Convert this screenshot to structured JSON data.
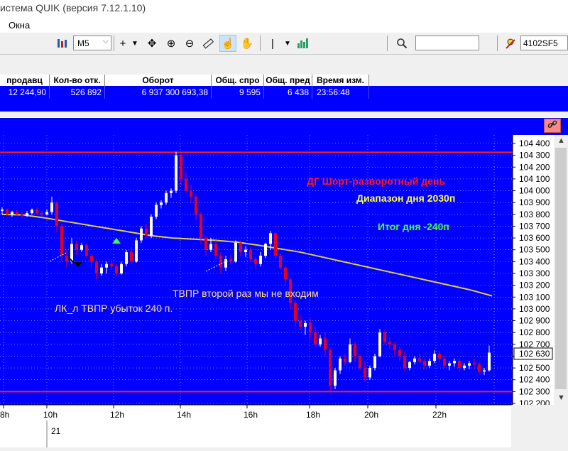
{
  "window": {
    "title": "истема QUIK (версия 7.12.1.10)"
  },
  "menu": {
    "items": [
      "Окна"
    ]
  },
  "toolbar": {
    "timeframe": "M5",
    "instrument": "4102SF5",
    "search_value": ""
  },
  "table": {
    "columns": [
      "продавц",
      "Кол-во отк.",
      "Оборот",
      "Общ. спро",
      "Общ. пред",
      "Время изм."
    ],
    "row": [
      "12 244,90",
      "526 892",
      "6 937 300 693,38",
      "9 595",
      "6 438",
      "23:56:48"
    ]
  },
  "chart": {
    "annotations": {
      "day_type": "ДГ Шорт-разворотный день",
      "day_range": "Диапазон дня 2030п",
      "day_total": "Итог дня -240п",
      "note_tvpr": "ТВПР второй раз мы не входим",
      "note_loss": "ЛК_л ТВПР убыток 240 п."
    },
    "current_price_label": "102 630",
    "date_label": "21",
    "colors": {
      "background": "#0000ff",
      "bull": "#ffffff",
      "bear": "#e8001a",
      "ma": "#e0d040",
      "level": "#ff2020",
      "grid": "#c0c0ff",
      "annotation_red": "#ff1a1a",
      "annotation_yellow": "#ffff40",
      "annotation_green": "#40ff40",
      "note_text": "#ffe080"
    }
  },
  "chart_data": {
    "type": "candlestick",
    "y_axis": {
      "min": 102200,
      "max": 104400,
      "ticks": [
        "104 400",
        "104 300",
        "104 200",
        "104 100",
        "104 000",
        "103 900",
        "103 800",
        "103 700",
        "103 600",
        "103 500",
        "103 400",
        "103 300",
        "103 200",
        "103 100",
        "103 000",
        "102 900",
        "102 800",
        "102 700",
        "102 600",
        "102 500",
        "102 400",
        "102 300",
        "102 200"
      ]
    },
    "x_axis": {
      "ticks": [
        "8h",
        "10h",
        "12h",
        "14h",
        "16h",
        "18h",
        "20h",
        "22h"
      ]
    },
    "levels": [
      104325,
      102300
    ],
    "ma_series": [
      [
        0,
        103800
      ],
      [
        5,
        103795
      ],
      [
        10,
        103770
      ],
      [
        15,
        103740
      ],
      [
        20,
        103710
      ],
      [
        25,
        103680
      ],
      [
        30,
        103650
      ],
      [
        35,
        103620
      ],
      [
        40,
        103600
      ],
      [
        45,
        103590
      ],
      [
        50,
        103580
      ],
      [
        55,
        103565
      ],
      [
        60,
        103540
      ],
      [
        65,
        103510
      ],
      [
        70,
        103480
      ],
      [
        75,
        103440
      ],
      [
        80,
        103400
      ],
      [
        85,
        103360
      ],
      [
        90,
        103320
      ],
      [
        95,
        103280
      ],
      [
        100,
        103240
      ],
      [
        105,
        103200
      ],
      [
        110,
        103160
      ],
      [
        115,
        103110
      ]
    ],
    "candles": [
      [
        0,
        103830,
        103860,
        103800,
        103840
      ],
      [
        1,
        103840,
        103850,
        103790,
        103800
      ],
      [
        2,
        103800,
        103830,
        103780,
        103820
      ],
      [
        3,
        103820,
        103840,
        103790,
        103800
      ],
      [
        4,
        103800,
        103820,
        103770,
        103790
      ],
      [
        5,
        103790,
        103830,
        103780,
        103810
      ],
      [
        6,
        103810,
        103850,
        103800,
        103840
      ],
      [
        7,
        103840,
        103860,
        103800,
        103810
      ],
      [
        8,
        103810,
        103830,
        103780,
        103800
      ],
      [
        9,
        103800,
        103840,
        103790,
        103820
      ],
      [
        10,
        103820,
        103950,
        103800,
        103900
      ],
      [
        11,
        103900,
        103910,
        103650,
        103700
      ],
      [
        12,
        103700,
        103720,
        103400,
        103450
      ],
      [
        13,
        103450,
        103500,
        103350,
        103400
      ],
      [
        14,
        103400,
        103600,
        103380,
        103550
      ],
      [
        15,
        103550,
        103580,
        103450,
        103500
      ],
      [
        16,
        103500,
        103560,
        103480,
        103540
      ],
      [
        17,
        103540,
        103550,
        103430,
        103450
      ],
      [
        18,
        103450,
        103470,
        103350,
        103400
      ],
      [
        19,
        103400,
        103420,
        103250,
        103300
      ],
      [
        20,
        103300,
        103380,
        103280,
        103350
      ],
      [
        21,
        103350,
        103400,
        103300,
        103380
      ],
      [
        22,
        103380,
        103420,
        103330,
        103360
      ],
      [
        23,
        103360,
        103380,
        103280,
        103300
      ],
      [
        24,
        103300,
        103400,
        103290,
        103380
      ],
      [
        25,
        103380,
        103500,
        103360,
        103480
      ],
      [
        26,
        103480,
        103520,
        103380,
        103400
      ],
      [
        27,
        103400,
        103600,
        103390,
        103580
      ],
      [
        28,
        103580,
        103700,
        103560,
        103680
      ],
      [
        29,
        103680,
        103720,
        103600,
        103620
      ],
      [
        30,
        103620,
        103800,
        103600,
        103780
      ],
      [
        31,
        103780,
        103900,
        103760,
        103880
      ],
      [
        32,
        103880,
        103920,
        103850,
        103900
      ],
      [
        33,
        103900,
        104000,
        103880,
        103980
      ],
      [
        34,
        103980,
        104020,
        103940,
        104000
      ],
      [
        35,
        104000,
        104330,
        103980,
        104300
      ],
      [
        36,
        104300,
        104320,
        104050,
        104100
      ],
      [
        37,
        104100,
        104150,
        103980,
        104000
      ],
      [
        38,
        104000,
        104050,
        103900,
        103950
      ],
      [
        39,
        103950,
        103970,
        103750,
        103800
      ],
      [
        40,
        103800,
        103820,
        103550,
        103600
      ],
      [
        41,
        103600,
        103620,
        103450,
        103500
      ],
      [
        42,
        103500,
        103600,
        103480,
        103550
      ],
      [
        43,
        103550,
        103580,
        103420,
        103450
      ],
      [
        44,
        103450,
        103480,
        103300,
        103350
      ],
      [
        45,
        103350,
        103450,
        103320,
        103420
      ],
      [
        46,
        103420,
        103460,
        103380,
        103400
      ],
      [
        47,
        103400,
        103580,
        103390,
        103560
      ],
      [
        48,
        103560,
        103580,
        103450,
        103480
      ],
      [
        49,
        103480,
        103530,
        103440,
        103500
      ],
      [
        50,
        103500,
        103520,
        103400,
        103420
      ],
      [
        51,
        103420,
        103440,
        103340,
        103380
      ],
      [
        52,
        103380,
        103480,
        103360,
        103450
      ],
      [
        53,
        103450,
        103560,
        103430,
        103550
      ],
      [
        54,
        103550,
        103660,
        103500,
        103640
      ],
      [
        55,
        103640,
        103650,
        103420,
        103450
      ],
      [
        56,
        103450,
        103470,
        103330,
        103350
      ],
      [
        57,
        103350,
        103370,
        103200,
        103250
      ],
      [
        58,
        103250,
        103270,
        103000,
        103050
      ],
      [
        59,
        103050,
        103070,
        102850,
        102900
      ],
      [
        60,
        102900,
        102950,
        102820,
        102850
      ],
      [
        61,
        102850,
        102900,
        102780,
        102880
      ],
      [
        62,
        102880,
        102920,
        102750,
        102800
      ],
      [
        63,
        102800,
        102850,
        102680,
        102700
      ],
      [
        64,
        102700,
        102780,
        102680,
        102750
      ],
      [
        65,
        102750,
        102800,
        102600,
        102650
      ],
      [
        66,
        102650,
        102670,
        102300,
        102350
      ],
      [
        67,
        102350,
        102500,
        102320,
        102480
      ],
      [
        68,
        102480,
        102600,
        102450,
        102580
      ],
      [
        69,
        102580,
        102620,
        102520,
        102550
      ],
      [
        70,
        102550,
        102750,
        102540,
        102700
      ],
      [
        71,
        102700,
        102720,
        102550,
        102600
      ],
      [
        72,
        102600,
        102620,
        102480,
        102500
      ],
      [
        73,
        102500,
        102560,
        102380,
        102420
      ],
      [
        74,
        102420,
        102520,
        102400,
        102500
      ],
      [
        75,
        102500,
        102620,
        102480,
        102600
      ],
      [
        76,
        102600,
        102830,
        102590,
        102800
      ],
      [
        77,
        102800,
        102820,
        102700,
        102720
      ],
      [
        78,
        102720,
        102760,
        102660,
        102700
      ],
      [
        79,
        102700,
        102720,
        102600,
        102650
      ],
      [
        80,
        102650,
        102680,
        102560,
        102600
      ],
      [
        81,
        102600,
        102640,
        102470,
        102500
      ],
      [
        82,
        102500,
        102560,
        102480,
        102550
      ],
      [
        83,
        102550,
        102600,
        102530,
        102580
      ],
      [
        84,
        102580,
        102620,
        102540,
        102560
      ],
      [
        85,
        102560,
        102580,
        102490,
        102520
      ],
      [
        86,
        102520,
        102580,
        102500,
        102560
      ],
      [
        87,
        102560,
        102650,
        102540,
        102620
      ],
      [
        88,
        102620,
        102640,
        102550,
        102580
      ],
      [
        89,
        102580,
        102600,
        102500,
        102520
      ],
      [
        90,
        102520,
        102560,
        102480,
        102540
      ],
      [
        91,
        102540,
        102580,
        102510,
        102560
      ],
      [
        92,
        102560,
        102580,
        102470,
        102500
      ],
      [
        93,
        102500,
        102540,
        102480,
        102520
      ],
      [
        94,
        102520,
        102560,
        102490,
        102540
      ],
      [
        95,
        102540,
        102580,
        102510,
        102530
      ],
      [
        96,
        102530,
        102550,
        102450,
        102470
      ],
      [
        97,
        102470,
        102500,
        102440,
        102480
      ],
      [
        98,
        102480,
        102690,
        102470,
        102630
      ]
    ]
  }
}
